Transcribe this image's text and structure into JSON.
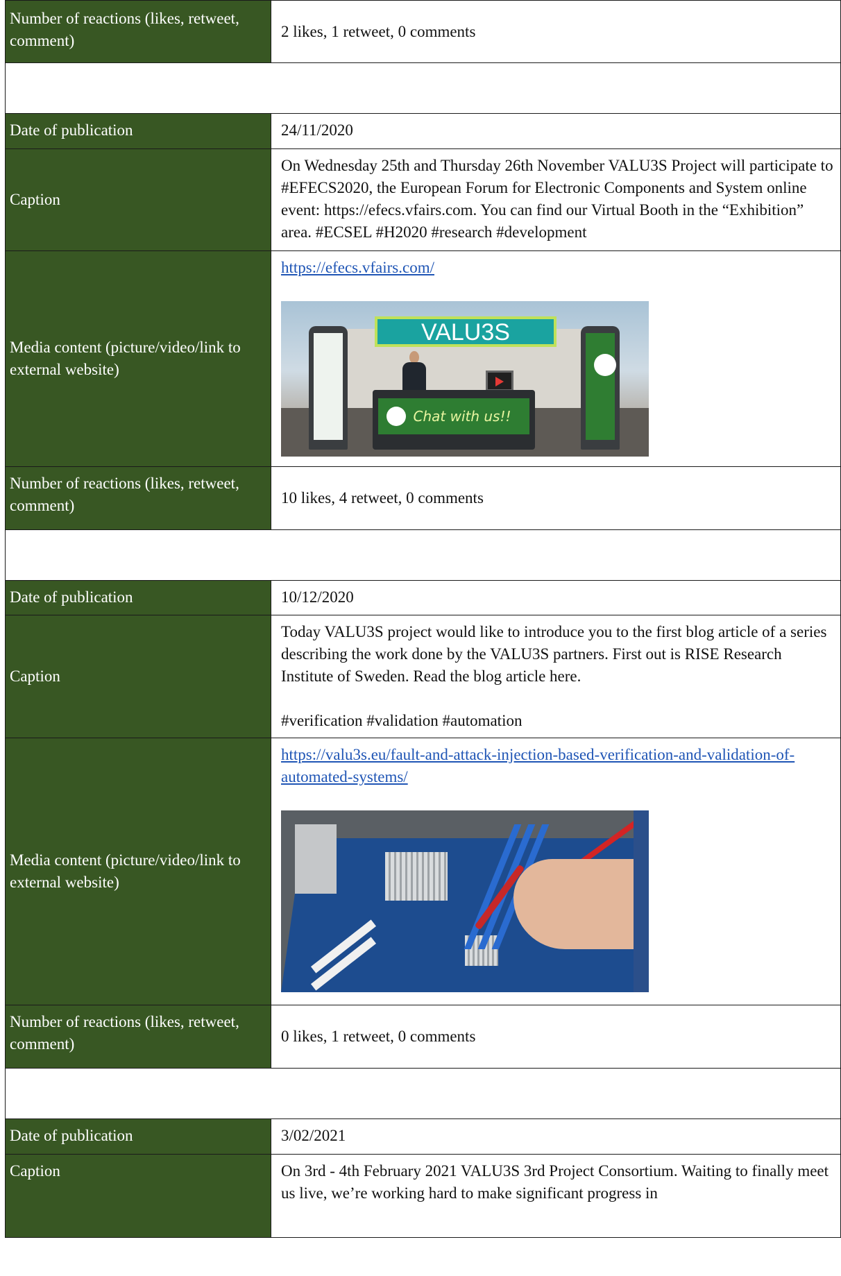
{
  "labels": {
    "reactions": "Number of reactions (likes, retweet, comment)",
    "date": "Date of publication",
    "caption": "Caption",
    "media": "Media content (picture/video/link to external website)"
  },
  "rows": {
    "r1_reactions": "2 likes, 1 retweet, 0 comments",
    "p2_date": "24/11/2020",
    "p2_caption": "On Wednesday 25th and Thursday 26th November VALU3S Project will participate to #EFECS2020, the European Forum for Electronic Components and System online event: https://efecs.vfairs.com. You can find our Virtual Booth in the “Exhibition” area. #ECSEL #H2020 #research #development",
    "p2_link": "https://efecs.vfairs.com/",
    "p2_image_sign": "VALU3S",
    "p2_image_chat": "Chat with us!!",
    "p2_reactions": "10 likes, 4 retweet, 0 comments",
    "p3_date": "10/12/2020",
    "p3_caption_1": "Today VALU3S project would like to introduce you to the first blog article of a series describing the work done by the VALU3S partners. First out is RISE Research Institute of Sweden. Read the blog article here.",
    "p3_caption_2": "#verification #validation #automation",
    "p3_link": "https://valu3s.eu/fault-and-attack-injection-based-verification-and-validation-of-automated-systems/",
    "p3_reactions": "0 likes, 1 retweet, 0 comments",
    "p4_date": "3/02/2021",
    "p4_caption": "On 3rd - 4th February 2021 VALU3S 3rd Project Consortium. Waiting to finally meet us live, we’re working hard to make significant progress in"
  },
  "colors": {
    "label_bg": "#385723",
    "link": "#1f55b5"
  },
  "images": [
    "virtual-booth-photo",
    "motherboard-testing-photo"
  ]
}
